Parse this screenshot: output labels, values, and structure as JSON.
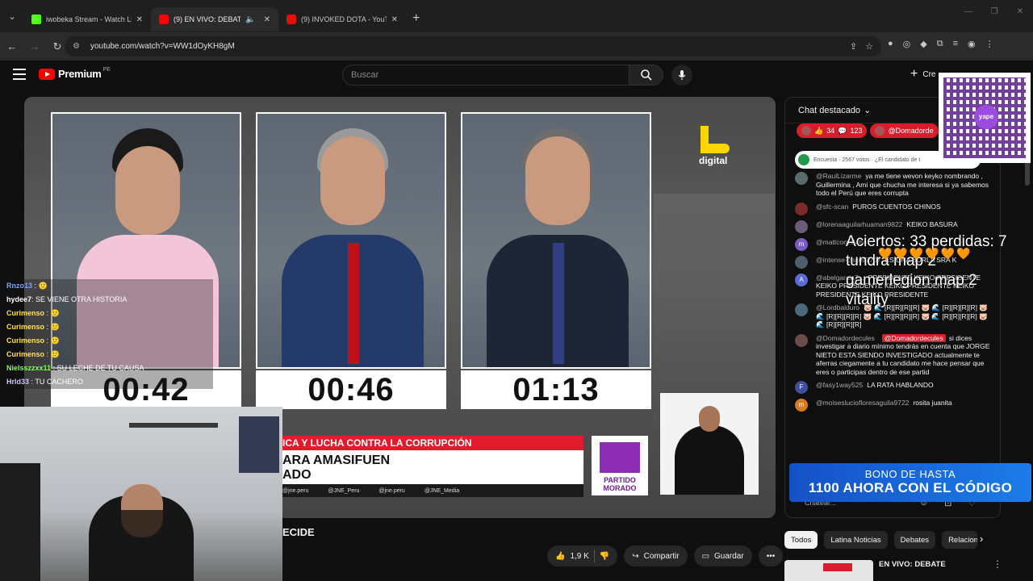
{
  "browser": {
    "tabs": [
      {
        "label": "iwobeka Stream - Watch Live o",
        "favicon_color": "#53fc18",
        "active": false
      },
      {
        "label": "(9) EN VIVO: DEBATE PRESI",
        "favicon_color": "#ff0000",
        "active": true
      },
      {
        "label": "(9) INVOKED DOTA - YouTube",
        "favicon_color": "#ff0000",
        "active": false
      }
    ],
    "url": "youtube.com/watch?v=WW1dOyKH8gM"
  },
  "youtube": {
    "brand": "Premium",
    "region": "PE",
    "search_placeholder": "Buscar",
    "create_label": "Cre"
  },
  "video": {
    "timers": [
      "00:42",
      "00:46",
      "01:13"
    ],
    "channel_logo": "digital",
    "banner_red": "ICA Y LUCHA CONTRA LA CORRUPCIÓN",
    "banner_name": "ARA AMASIFUEN",
    "banner_sub": "ADO",
    "socials": [
      "@jne.peru",
      "@JNE_Peru",
      "@jne.peru",
      "@JNE_Media"
    ],
    "party": "PARTIDO MORADO",
    "title_fragment": "ECIDE"
  },
  "stream_chat": [
    {
      "user": "Rnzo13",
      "text": "",
      "color": "#7aa2ff"
    },
    {
      "user": "hydee7",
      "text": ": SE VIENE OTRA HISTORIA",
      "color": "#ffffff"
    },
    {
      "user": "Curimenso",
      "text": ":",
      "color": "#ffe24a"
    },
    {
      "user": "Curimenso",
      "text": ":",
      "color": "#ffe24a"
    },
    {
      "user": "Curimenso",
      "text": ":",
      "color": "#ffe24a"
    },
    {
      "user": "Curimenso",
      "text": ":",
      "color": "#ffe24a"
    },
    {
      "user": "Nielsszzxx11",
      "text": ": SU LECHE DE TU CAUSA",
      "color": "#7dff5a"
    },
    {
      "user": "Hrld33",
      "text": ": TU CACHERO",
      "color": "#c8c8ff"
    }
  ],
  "overlay": {
    "line1": "Aciertos: 33 perdidas: 7",
    "line2": "tundra map 2",
    "line3": "gamerlegion map 2",
    "line4": "vitality",
    "hearts": "🧡🧡🧡🧡🧡🧡"
  },
  "qr_label": "yape",
  "promo": {
    "line1": "BONO DE HASTA",
    "line2": "1100 AHORA CON EL CÓDIGO"
  },
  "chat": {
    "header": "Chat destacado",
    "chips": [
      {
        "icon": "👍",
        "a": "34",
        "b": "123"
      },
      {
        "label": "@Domadorde"
      }
    ],
    "poll": "Encuesta · 2567 votos · ¿El candidato de t",
    "messages": [
      {
        "author": "@RaulLizarme",
        "text": "ya me tiene wevon keyko nombrando , Guillermina , Ami que chucha me interesa si ya sabemos todo el Perú que eres corrupta",
        "av": "#5b6b6b",
        "initial": ""
      },
      {
        "author": "@sfc-scan",
        "text": "PUROS CUENTOS CHINOS",
        "av": "#7a2b2b",
        "initial": ""
      },
      {
        "author": "@lorenaaguilarhuaman9822",
        "text": "KEIKO BASURA",
        "av": "#6b5b7a",
        "initial": ""
      },
      {
        "author": "@mattcorp.8464",
        "text": "",
        "av": "#7b5cc4",
        "initial": "m"
      },
      {
        "author": "@intense-chaos7707",
        "text": "ES UNA BURLA SRA K",
        "av": "#4e5e6e",
        "initial": ""
      },
      {
        "author": "@abelgarcia7...",
        "text": "PRESIDENTE KEIKO PRESIDENTE KEIKO PRESIDENTE KEIKO PRESIDENTE KEIKO PRESIDENTE KEIKO PRESIDENTE",
        "av": "#5a6dd6",
        "initial": "A"
      },
      {
        "author": "@Lordbalduro",
        "text": "🐷 🌊 [R][R][R][R] 🐷 🌊 [R][R][R][R] 🐷 🌊 [R][R][R][R] 🐷 🌊 [R][R][R][R] 🐷 🌊 [R][R][R][R] 🐷 🌊 [R][R][R][R]",
        "av": "#4d6a7a",
        "initial": ""
      },
      {
        "author": "@Domadordecules",
        "tag": "@Domadordecules",
        "text": "si dices investigar a diario mínimo tendrás en cuenta que JORGE NIETO ESTA SIENDO INVESTIGADO actualmente te aferras ciegamente a tu candidato me hace pensar que eres o participas dentro de ese partid",
        "av": "#6a4a4a",
        "initial": ""
      },
      {
        "author": "@fasy1way525",
        "text": "LA RATA HABLANDO",
        "av": "#3c4fa0",
        "initial": "F"
      },
      {
        "author": "@moiseslucioflores​aguila9722",
        "text": "rosita juanita",
        "av": "#d87a20",
        "initial": "m"
      }
    ],
    "input_placeholder": "Chatear..."
  },
  "actions": {
    "likes": "1,9 K",
    "share": "Compartir",
    "save": "Guardar"
  },
  "filters": [
    "Todos",
    "Latina Noticias",
    "Debates",
    "Relacion"
  ],
  "recommendation": {
    "title": "EN VIVO: DEBATE"
  }
}
